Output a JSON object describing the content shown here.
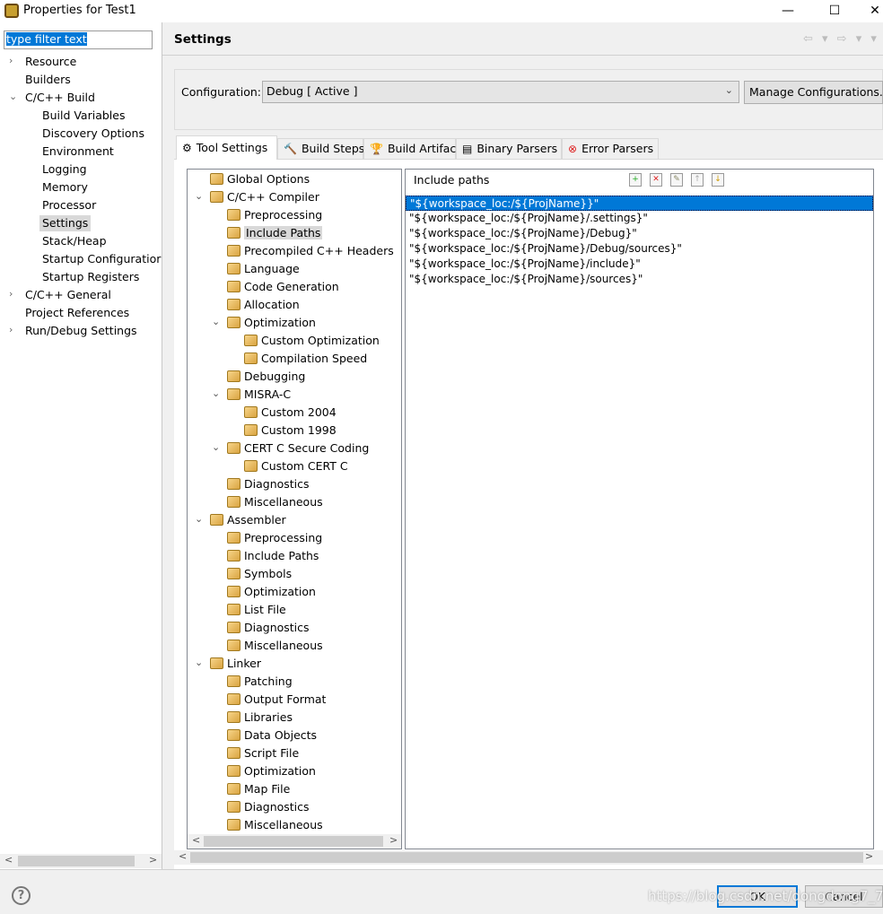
{
  "window": {
    "title": "Properties for Test1",
    "minimize": "—",
    "maximize": "☐",
    "close": "✕"
  },
  "filter": {
    "value": "type filter text"
  },
  "nav": [
    {
      "label": "Resource",
      "level": 0,
      "chevron": "›"
    },
    {
      "label": "Builders",
      "level": 0
    },
    {
      "label": "C/C++ Build",
      "level": 0,
      "chevron": "⌄"
    },
    {
      "label": "Build Variables",
      "level": 1
    },
    {
      "label": "Discovery Options",
      "level": 1
    },
    {
      "label": "Environment",
      "level": 1
    },
    {
      "label": "Logging",
      "level": 1
    },
    {
      "label": "Memory",
      "level": 1
    },
    {
      "label": "Processor",
      "level": 1
    },
    {
      "label": "Settings",
      "level": 1,
      "selected": true
    },
    {
      "label": "Stack/Heap",
      "level": 1
    },
    {
      "label": "Startup Configuratior",
      "level": 1
    },
    {
      "label": "Startup Registers",
      "level": 1
    },
    {
      "label": "C/C++ General",
      "level": 0,
      "chevron": "›"
    },
    {
      "label": "Project References",
      "level": 0
    },
    {
      "label": "Run/Debug Settings",
      "level": 0,
      "chevron": "›"
    }
  ],
  "header": {
    "title": "Settings",
    "nav_arrows": "⇦ ▾ ⇨ ▾ ▾"
  },
  "config": {
    "label": "Configuration:",
    "value": "Debug  [ Active ]",
    "manage_button": "Manage Configurations..."
  },
  "tabs": [
    {
      "label": "Tool Settings",
      "icon": "tool-settings-icon",
      "glyph": "⚙",
      "active": true
    },
    {
      "label": "Build Steps",
      "icon": "build-steps-icon",
      "glyph": "🔨"
    },
    {
      "label": "Build Artifact",
      "icon": "trophy-icon",
      "glyph": "🏆"
    },
    {
      "label": "Binary Parsers",
      "icon": "binary-file-icon",
      "glyph": "▤"
    },
    {
      "label": "Error Parsers",
      "icon": "error-icon",
      "glyph": "⊗"
    }
  ],
  "tool_tree": [
    {
      "label": "Global Options",
      "level": 0
    },
    {
      "label": "C/C++ Compiler",
      "level": 0,
      "expanded": true
    },
    {
      "label": "Preprocessing",
      "level": 1
    },
    {
      "label": "Include Paths",
      "level": 1,
      "selected": true
    },
    {
      "label": "Precompiled C++ Headers",
      "level": 1
    },
    {
      "label": "Language",
      "level": 1
    },
    {
      "label": "Code Generation",
      "level": 1
    },
    {
      "label": "Allocation",
      "level": 1
    },
    {
      "label": "Optimization",
      "level": 1,
      "expanded": true
    },
    {
      "label": "Custom Optimization",
      "level": 2
    },
    {
      "label": "Compilation Speed",
      "level": 2
    },
    {
      "label": "Debugging",
      "level": 1
    },
    {
      "label": "MISRA-C",
      "level": 1,
      "expanded": true
    },
    {
      "label": "Custom 2004",
      "level": 2
    },
    {
      "label": "Custom 1998",
      "level": 2
    },
    {
      "label": "CERT C Secure Coding",
      "level": 1,
      "expanded": true
    },
    {
      "label": "Custom CERT C",
      "level": 2
    },
    {
      "label": "Diagnostics",
      "level": 1
    },
    {
      "label": "Miscellaneous",
      "level": 1
    },
    {
      "label": "Assembler",
      "level": 0,
      "expanded": true
    },
    {
      "label": "Preprocessing",
      "level": 1
    },
    {
      "label": "Include Paths",
      "level": 1
    },
    {
      "label": "Symbols",
      "level": 1
    },
    {
      "label": "Optimization",
      "level": 1
    },
    {
      "label": "List File",
      "level": 1
    },
    {
      "label": "Diagnostics",
      "level": 1
    },
    {
      "label": "Miscellaneous",
      "level": 1
    },
    {
      "label": "Linker",
      "level": 0,
      "expanded": true
    },
    {
      "label": "Patching",
      "level": 1
    },
    {
      "label": "Output Format",
      "level": 1
    },
    {
      "label": "Libraries",
      "level": 1
    },
    {
      "label": "Data Objects",
      "level": 1
    },
    {
      "label": "Script File",
      "level": 1
    },
    {
      "label": "Optimization",
      "level": 1
    },
    {
      "label": "Map File",
      "level": 1
    },
    {
      "label": "Diagnostics",
      "level": 1
    },
    {
      "label": "Miscellaneous",
      "level": 1
    }
  ],
  "include_paths": {
    "title": "Include paths",
    "toolbar": [
      {
        "name": "add-icon",
        "glyph": "+"
      },
      {
        "name": "delete-icon",
        "glyph": "✕"
      },
      {
        "name": "edit-icon",
        "glyph": "✎"
      },
      {
        "name": "move-up-icon",
        "glyph": "↑"
      },
      {
        "name": "move-down-icon",
        "glyph": "↓"
      }
    ],
    "items": [
      "\"${workspace_loc:/${ProjName}}\"",
      "\"${workspace_loc:/${ProjName}/.settings}\"",
      "\"${workspace_loc:/${ProjName}/Debug}\"",
      "\"${workspace_loc:/${ProjName}/Debug/sources}\"",
      "\"${workspace_loc:/${ProjName}/include}\"",
      "\"${workspace_loc:/${ProjName}/sources}\""
    ]
  },
  "footer": {
    "help": "?",
    "ok": "OK",
    "cancel": "Cancel",
    "watermark": "https://blog.csdn.net/dongdong7_77"
  },
  "colors": {
    "selection": "#0078d7"
  }
}
